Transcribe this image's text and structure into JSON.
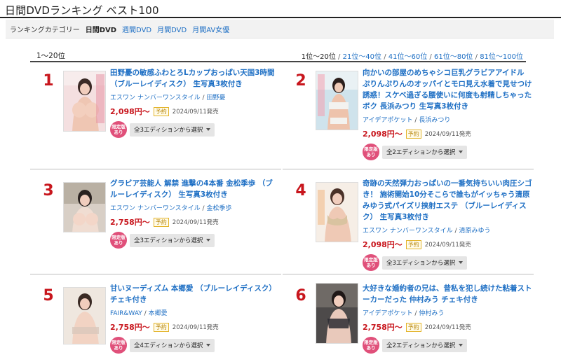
{
  "page": {
    "title": "日間DVDランキング ベスト100"
  },
  "category_bar": {
    "label": "ランキングカテゴリー",
    "current": "日間DVD",
    "links": [
      "週間DVD",
      "月間DVD",
      "月間AV女優"
    ]
  },
  "range": {
    "current": "1〜20位",
    "links_current": "1位〜20位",
    "links": [
      "21位〜40位",
      "41位〜60位",
      "61位〜80位",
      "81位〜100位"
    ],
    "separator": "/"
  },
  "items": [
    {
      "rank": "1",
      "title": "田野憂の敏感ふわとろLカップおっぱい天国3時間 （ブルーレイディスク） 生写真3枚付き",
      "maker": "エスワン ナンバーワンスタイル",
      "actress": "田野憂",
      "price": "2,098円〜",
      "badge": "予約",
      "release": "2024/09/11発売",
      "limited": "限定版あり",
      "edition_label": "全3エディションから選択"
    },
    {
      "rank": "2",
      "title": "向かいの部屋のめちゃシコ巨乳グラビアアイドル ぷりんぷりんのオッパイとモロ見え水着で見せつけ誘惑！スケベ過ぎる腰使いに何度も射精しちゃったボク 長浜みつり 生写真3枚付き",
      "maker": "アイデアポケット",
      "actress": "長浜みつり",
      "price": "2,098円〜",
      "badge": "予約",
      "release": "2024/09/11発売",
      "limited": "限定版あり",
      "edition_label": "全2エディションから選択"
    },
    {
      "rank": "3",
      "title": "グラビア芸能人 解禁 進撃の4本番 金松季歩 （ブルーレイディスク） 生写真3枚付き",
      "maker": "エスワン ナンバーワンスタイル",
      "actress": "金松季歩",
      "price": "2,758円〜",
      "badge": "予約",
      "release": "2024/09/11発売",
      "limited": "限定版あり",
      "edition_label": "全3エディションから選択"
    },
    {
      "rank": "4",
      "title": "奇跡の天然弾力おっぱいの一番気持ちいい肉圧シゴき！ 施術開始10分そこらで誰もがイッちゃう清原みゆう式パイズリ挟射エステ （ブルーレイディスク） 生写真3枚付き",
      "maker": "エスワン ナンバーワンスタイル",
      "actress": "清原みゆう",
      "price": "2,098円〜",
      "badge": "予約",
      "release": "2024/09/11発売",
      "limited": "限定版あり",
      "edition_label": "全3エディションから選択"
    },
    {
      "rank": "5",
      "title": "甘いヌーディズム 本郷愛 （ブルーレイディスク） チェキ付き",
      "maker": "FAIR&WAY",
      "actress": "本郷愛",
      "price": "2,758円〜",
      "badge": "予約",
      "release": "2024/09/11発売",
      "limited": "限定版あり",
      "edition_label": "全4エディションから選択"
    },
    {
      "rank": "6",
      "title": "大好きな婚約者の兄は、昔私を犯し続けた粘着ストーカーだった 仲村みう チェキ付き",
      "maker": "アイデアポケット",
      "actress": "仲村みう",
      "price": "2,758円〜",
      "badge": "予約",
      "release": "2024/09/11発売",
      "limited": "限定版あり",
      "edition_label": "全2エディションから選択"
    }
  ],
  "colors": {
    "rank": "#c8161d",
    "link": "#1e6fc4",
    "price": "#c8161d",
    "limited_badge": "#e0507a",
    "reserve_badge_border": "#e3b42b"
  }
}
